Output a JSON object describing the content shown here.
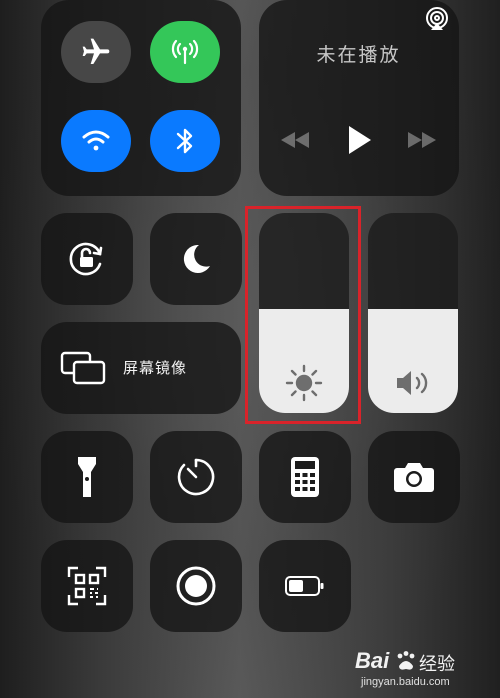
{
  "connectivity": {
    "airplane_icon": "airplane-icon",
    "cellular_icon": "cellular-icon",
    "wifi_icon": "wifi-icon",
    "bluetooth_icon": "bluetooth-icon",
    "airplane_active": false,
    "cellular_active": true,
    "wifi_active": true,
    "bluetooth_active": true
  },
  "now_playing": {
    "title": "未在播放",
    "airplay_icon": "airplay-icon",
    "controls": [
      "rewind-icon",
      "play-icon",
      "fast-forward-icon"
    ]
  },
  "controls": {
    "rotation_lock_icon": "rotation-lock-icon",
    "do_not_disturb_icon": "moon-icon",
    "screen_mirroring_label": "屏幕镜像",
    "flashlight_icon": "flashlight-icon",
    "timer_icon": "timer-icon",
    "calculator_icon": "calculator-icon",
    "camera_icon": "camera-icon",
    "qr_scanner_icon": "qr-scanner-icon",
    "screen_record_icon": "record-icon",
    "low_power_icon": "battery-icon"
  },
  "sliders": {
    "brightness_level": 0.52,
    "volume_level": 0.52
  },
  "annotation": {
    "highlight_color": "#d9232a"
  },
  "watermark": {
    "brand": "Bai",
    "brand_suffix": "经验",
    "url": "jingyan.baidu.com"
  },
  "colors": {
    "green": "#34c759",
    "blue": "#0a7aff",
    "tile": "#1c1c1c"
  }
}
